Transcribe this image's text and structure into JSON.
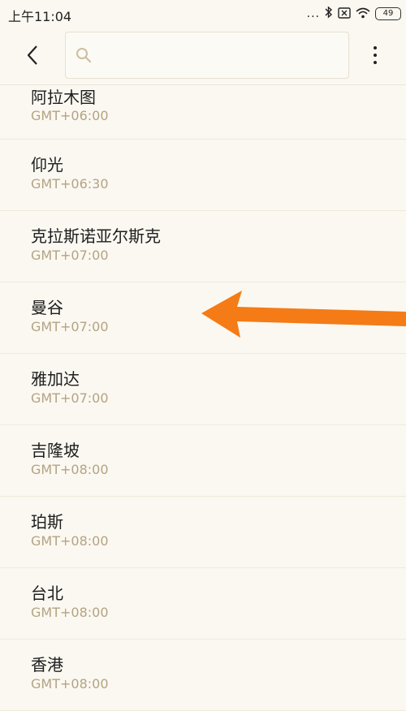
{
  "status_bar": {
    "time": "上午11:04",
    "dots": "...",
    "battery": "49",
    "icons": [
      "bluetooth-icon",
      "sim-none-icon",
      "wifi-icon",
      "battery-icon"
    ]
  },
  "toolbar": {
    "back_icon": "back-icon",
    "search_icon": "search-icon",
    "search_value": "",
    "more_icon": "more-vertical-icon"
  },
  "timezones": [
    {
      "city": "阿拉木图",
      "offset": "GMT+06:00"
    },
    {
      "city": "仰光",
      "offset": "GMT+06:30"
    },
    {
      "city": "克拉斯诺亚尔斯克",
      "offset": "GMT+07:00"
    },
    {
      "city": "曼谷",
      "offset": "GMT+07:00"
    },
    {
      "city": "雅加达",
      "offset": "GMT+07:00"
    },
    {
      "city": "吉隆坡",
      "offset": "GMT+08:00"
    },
    {
      "city": "珀斯",
      "offset": "GMT+08:00"
    },
    {
      "city": "台北",
      "offset": "GMT+08:00"
    },
    {
      "city": "香港",
      "offset": "GMT+08:00"
    }
  ],
  "colors": {
    "background": "#fbf8f1",
    "offset_text": "#b3a384",
    "annotation_arrow": "#f47b16"
  }
}
